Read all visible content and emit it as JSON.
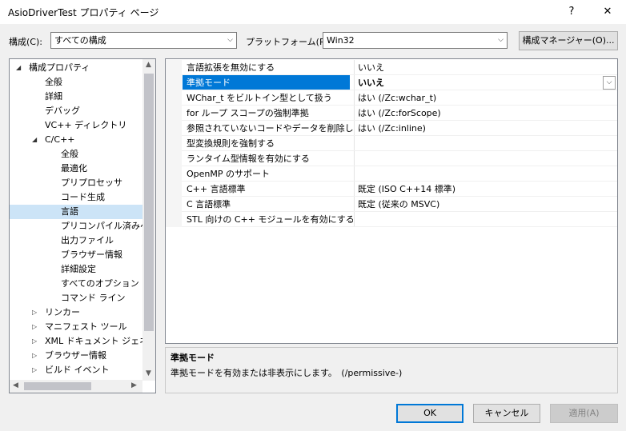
{
  "window": {
    "title": "AsioDriverTest プロパティ ページ",
    "help_glyph": "?",
    "close_glyph": "✕"
  },
  "toolbar": {
    "config_label": "構成(C):",
    "config_value": "すべての構成",
    "platform_label": "プラットフォーム(P):",
    "platform_value": "Win32",
    "config_manager_label": "構成マネージャー(O)..."
  },
  "tree": {
    "items": [
      {
        "label": "構成プロパティ",
        "level": 0,
        "expander": "expanded"
      },
      {
        "label": "全般",
        "level": 1,
        "expander": "none"
      },
      {
        "label": "詳細",
        "level": 1,
        "expander": "none"
      },
      {
        "label": "デバッグ",
        "level": 1,
        "expander": "none"
      },
      {
        "label": "VC++ ディレクトリ",
        "level": 1,
        "expander": "none"
      },
      {
        "label": "C/C++",
        "level": 1,
        "expander": "expanded"
      },
      {
        "label": "全般",
        "level": 2,
        "expander": "none"
      },
      {
        "label": "最適化",
        "level": 2,
        "expander": "none"
      },
      {
        "label": "プリプロセッサ",
        "level": 2,
        "expander": "none"
      },
      {
        "label": "コード生成",
        "level": 2,
        "expander": "none"
      },
      {
        "label": "言語",
        "level": 2,
        "expander": "none",
        "selected": true
      },
      {
        "label": "プリコンパイル済みヘッ",
        "level": 2,
        "expander": "none"
      },
      {
        "label": "出力ファイル",
        "level": 2,
        "expander": "none"
      },
      {
        "label": "ブラウザー情報",
        "level": 2,
        "expander": "none"
      },
      {
        "label": "詳細設定",
        "level": 2,
        "expander": "none"
      },
      {
        "label": "すべてのオプション",
        "level": 2,
        "expander": "none"
      },
      {
        "label": "コマンド ライン",
        "level": 2,
        "expander": "none"
      },
      {
        "label": "リンカー",
        "level": 1,
        "expander": "collapsed"
      },
      {
        "label": "マニフェスト ツール",
        "level": 1,
        "expander": "collapsed"
      },
      {
        "label": "XML ドキュメント ジェネレー",
        "level": 1,
        "expander": "collapsed"
      },
      {
        "label": "ブラウザー情報",
        "level": 1,
        "expander": "collapsed"
      },
      {
        "label": "ビルド イベント",
        "level": 1,
        "expander": "collapsed"
      }
    ]
  },
  "grid": {
    "rows": [
      {
        "name": "言語拡張を無効にする",
        "value": "いいえ"
      },
      {
        "name": "準拠モード",
        "value": "いいえ",
        "selected": true
      },
      {
        "name": "WChar_t をビルトイン型として扱う",
        "value": "はい (/Zc:wchar_t)"
      },
      {
        "name": "for ループ スコープの強制準拠",
        "value": "はい (/Zc:forScope)"
      },
      {
        "name": "参照されていないコードやデータを削除します",
        "value": "はい (/Zc:inline)"
      },
      {
        "name": "型変換規則を強制する",
        "value": ""
      },
      {
        "name": "ランタイム型情報を有効にする",
        "value": ""
      },
      {
        "name": "OpenMP のサポート",
        "value": ""
      },
      {
        "name": "C++ 言語標準",
        "value": "既定 (ISO C++14 標準)"
      },
      {
        "name": "C 言語標準",
        "value": "既定 (従来の MSVC)"
      },
      {
        "name": "STL 向けの C++ モジュールを有効にする (試験段階)",
        "value": ""
      }
    ]
  },
  "description": {
    "title": "準拠モード",
    "text": "準拠モードを有効または非表示にします。　(/permissive-)"
  },
  "buttons": {
    "ok": "OK",
    "cancel": "キャンセル",
    "apply": "適用(A)"
  }
}
